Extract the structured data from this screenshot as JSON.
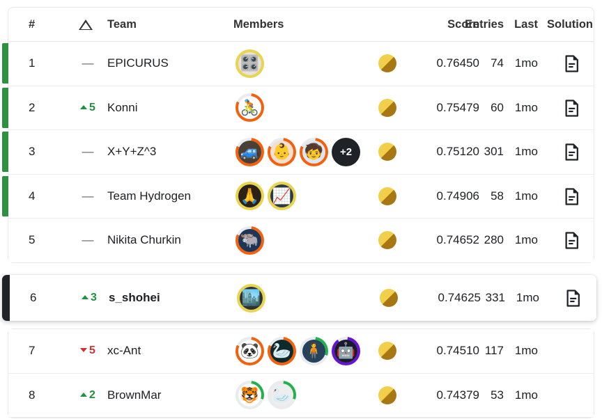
{
  "columns": {
    "rank": "#",
    "delta_icon": "delta-triangle-icon",
    "team": "Team",
    "members": "Members",
    "score": "Score",
    "entries": "Entries",
    "last": "Last",
    "solution": "Solution"
  },
  "icons": {
    "medal": "gold-medal-icon",
    "solution": "solution-document-icon",
    "delta_up": "arrow-up-icon",
    "delta_down": "arrow-down-icon",
    "delta_flat": "—"
  },
  "colors": {
    "tier_gold": "#f2cf4a",
    "tier_gold_dark": "#a87613",
    "green_bar": "#2e9141",
    "delta_up": "#1f9141",
    "delta_down": "#d32f2f",
    "me_bar": "#1f2226",
    "border": "#e5e7eb"
  },
  "rows": [
    {
      "rank": "1",
      "delta": "—",
      "delta_dir": "flat",
      "team": "EPICURUS",
      "medal": "gold",
      "score": "0.76450",
      "entries": "74",
      "last": "1mo",
      "has_solution": true,
      "tier_bar": true,
      "highlighted": false,
      "members": [
        {
          "ring": "gold",
          "bg": "#e8e2da",
          "emoji": "🎛️"
        }
      ],
      "extra_members": null
    },
    {
      "rank": "2",
      "delta": "5",
      "delta_dir": "up",
      "team": "Konni",
      "medal": "gold",
      "score": "0.75479",
      "entries": "60",
      "last": "1mo",
      "has_solution": true,
      "tier_bar": true,
      "highlighted": false,
      "members": [
        {
          "ring": "orange",
          "bg": "#ffffff",
          "emoji": "🚴"
        }
      ],
      "extra_members": null
    },
    {
      "rank": "3",
      "delta": "—",
      "delta_dir": "flat",
      "team": "X+Y+Z^3",
      "medal": "gold",
      "score": "0.75120",
      "entries": "301",
      "last": "1mo",
      "has_solution": true,
      "tier_bar": true,
      "highlighted": false,
      "members": [
        {
          "ring": "orange",
          "bg": "#4a4036",
          "emoji": "🚙"
        },
        {
          "ring": "orange",
          "bg": "#f3ded0",
          "emoji": "👶"
        },
        {
          "ring": "orange",
          "bg": "#dce6f0",
          "emoji": "🧒"
        }
      ],
      "extra_members": "+2"
    },
    {
      "rank": "4",
      "delta": "—",
      "delta_dir": "flat",
      "team": "Team Hydrogen",
      "medal": "gold",
      "score": "0.74906",
      "entries": "58",
      "last": "1mo",
      "has_solution": true,
      "tier_bar": true,
      "highlighted": false,
      "members": [
        {
          "ring": "gold",
          "bg": "#2b2118",
          "emoji": "🙏"
        },
        {
          "ring": "gold",
          "bg": "#2b3a44",
          "emoji": "📈"
        }
      ],
      "extra_members": null
    },
    {
      "rank": "5",
      "delta": "—",
      "delta_dir": "flat",
      "team": "Nikita Churkin",
      "medal": "gold",
      "score": "0.74652",
      "entries": "280",
      "last": "1mo",
      "has_solution": true,
      "tier_bar": false,
      "highlighted": false,
      "members": [
        {
          "ring": "orange",
          "bg": "#1d3557",
          "emoji": "🐃"
        }
      ],
      "extra_members": null
    },
    {
      "rank": "6",
      "delta": "3",
      "delta_dir": "up",
      "team": "s_shohei",
      "medal": "gold",
      "score": "0.74625",
      "entries": "331",
      "last": "1mo",
      "has_solution": true,
      "tier_bar": false,
      "highlighted": true,
      "members": [
        {
          "ring": "gold",
          "bg": "#2e3235",
          "emoji": "🏙️"
        }
      ],
      "extra_members": null
    },
    {
      "rank": "7",
      "delta": "5",
      "delta_dir": "down",
      "team": "xc-Ant",
      "medal": "gold",
      "score": "0.74510",
      "entries": "117",
      "last": "1mo",
      "has_solution": false,
      "tier_bar": false,
      "highlighted": false,
      "members": [
        {
          "ring": "orange",
          "bg": "#ffffff",
          "emoji": "🐼"
        },
        {
          "ring": "orange",
          "bg": "#0d2b2b",
          "emoji": "🦢"
        },
        {
          "ring": "green",
          "bg": "#26425c",
          "emoji": "🧍"
        },
        {
          "ring": "purple",
          "bg": "#1a1c2e",
          "emoji": "🤖"
        }
      ],
      "extra_members": null
    },
    {
      "rank": "8",
      "delta": "2",
      "delta_dir": "up",
      "team": "BrownMar",
      "medal": "gold",
      "score": "0.74379",
      "entries": "53",
      "last": "1mo",
      "has_solution": false,
      "tier_bar": false,
      "highlighted": false,
      "members": [
        {
          "ring": "green",
          "bg": "#ffffff",
          "emoji": "🐯"
        },
        {
          "ring": "green",
          "bg": "#eeeeee",
          "emoji": "🦢"
        }
      ],
      "extra_members": null
    }
  ]
}
